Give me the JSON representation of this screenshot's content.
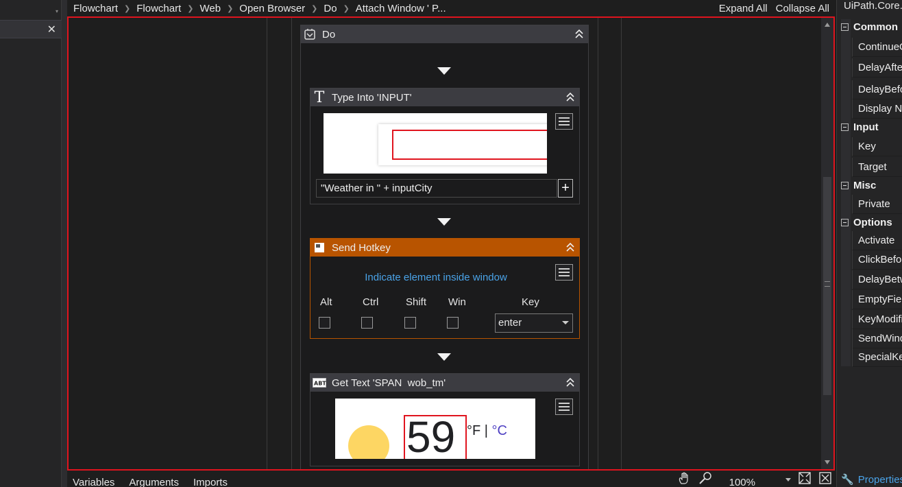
{
  "breadcrumb": {
    "items": [
      "Flowchart",
      "Flowchart",
      "Web",
      "Open Browser",
      "Do",
      "Attach Window ' P..."
    ],
    "expand_all": "Expand All",
    "collapse_all": "Collapse All"
  },
  "do_block": {
    "title": "Do"
  },
  "type_into": {
    "title": "Type Into 'INPUT'",
    "text_value": "\"Weather in \" + inputCity"
  },
  "send_hotkey": {
    "title": "Send Hotkey",
    "indicate": "Indicate element inside window",
    "labels": {
      "alt": "Alt",
      "ctrl": "Ctrl",
      "shift": "Shift",
      "win": "Win",
      "key": "Key"
    },
    "key_value": "enter",
    "header_color": "#b85400"
  },
  "get_text": {
    "title": "Get Text 'SPAN  wob_tm'",
    "preview": {
      "temp": "59",
      "units_f": "°F | ",
      "units_c": "°C"
    }
  },
  "properties": {
    "title": "UiPath.Core.A",
    "categories": [
      {
        "label": "Common",
        "items": [
          "ContinueO",
          "DelayAfte",
          "DelayBefo",
          "Display Na"
        ]
      },
      {
        "label": "Input",
        "items": [
          "Key",
          "Target"
        ]
      },
      {
        "label": "Misc",
        "items": [
          "Private"
        ]
      },
      {
        "label": "Options",
        "items": [
          "Activate",
          "ClickBefor",
          "DelayBetw",
          "EmptyFiel",
          "KeyModifi",
          "SendWind",
          "SpecialKey"
        ]
      }
    ],
    "tab": "Properties"
  },
  "bottom": {
    "tabs": [
      "Variables",
      "Arguments",
      "Imports"
    ],
    "zoom": "100%"
  }
}
